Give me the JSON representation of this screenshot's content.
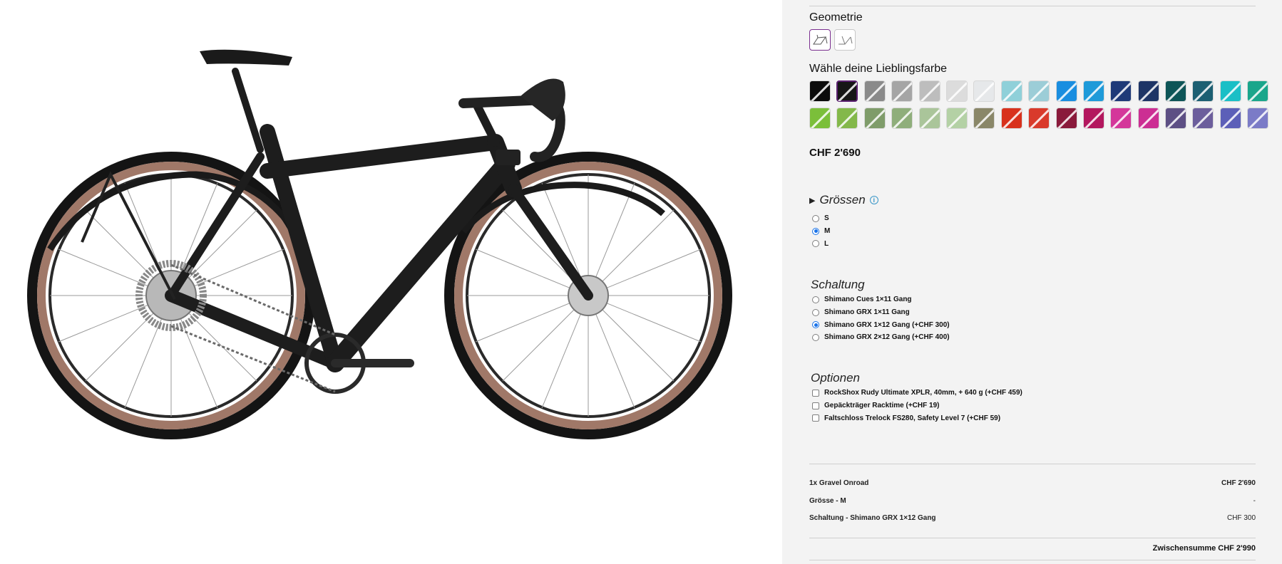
{
  "product": {
    "image_alt": "Gravel Onroad bike"
  },
  "configurator": {
    "geometry": {
      "title": "Geometrie",
      "options": [
        {
          "name": "diamond-frame",
          "selected": true
        },
        {
          "name": "step-through-frame",
          "selected": false
        }
      ]
    },
    "color": {
      "title": "Wähle deine Lieblingsfarbe",
      "swatches": [
        "#0b0b0b",
        "#161616",
        "#8a8a8a",
        "#a5a5a5",
        "#bdbdbd",
        "#dcdcdc",
        "#e6e8ea",
        "#8fd0d9",
        "#9ccdd7",
        "#1a8ee0",
        "#1e9ad9",
        "#1f3a78",
        "#1e3566",
        "#0e5557",
        "#1c5f72",
        "#1abfc6",
        "#1aa68b",
        "#7bbf3a",
        "#83b84a",
        "#7f9c6a",
        "#8fae7b",
        "#aac59a",
        "#b4d1a5",
        "#8a8768",
        "#d8311c",
        "#d93a2b",
        "#8a1a3b",
        "#b3175e",
        "#d4379a",
        "#cc2e93",
        "#5d4f84",
        "#6c5e9c",
        "#5c5fb8",
        "#7b7bc7"
      ],
      "selected_index": 1
    },
    "price": "CHF 2'690",
    "sizes": {
      "title": "Grössen",
      "options": [
        {
          "label": "S",
          "checked": false
        },
        {
          "label": "M",
          "checked": true
        },
        {
          "label": "L",
          "checked": false
        }
      ]
    },
    "gearing": {
      "title": "Schaltung",
      "options": [
        {
          "label": "Shimano Cues 1×11 Gang",
          "checked": false
        },
        {
          "label": "Shimano GRX 1×11 Gang",
          "checked": false
        },
        {
          "label": "Shimano GRX 1×12 Gang (+CHF 300)",
          "checked": true
        },
        {
          "label": "Shimano GRX 2×12 Gang (+CHF 400)",
          "checked": false
        }
      ]
    },
    "options": {
      "title": "Optionen",
      "items": [
        {
          "label": "RockShox Rudy Ultimate XPLR, 40mm, + 640 g (+CHF 459)",
          "checked": false
        },
        {
          "label": "Gepäckträger Racktime (+CHF 19)",
          "checked": false
        },
        {
          "label": "Faltschloss Trelock FS280, Safety Level 7 (+CHF 59)",
          "checked": false
        }
      ]
    },
    "summary": {
      "rows": [
        {
          "label": "1x Gravel Onroad",
          "value": "CHF 2'690"
        },
        {
          "label": "Grösse - M",
          "value": "-"
        },
        {
          "label": "Schaltung - Shimano GRX 1×12 Gang",
          "value": "CHF 300"
        }
      ],
      "subtotal_label": "Zwischensumme",
      "subtotal_value": "CHF 2'990"
    }
  }
}
